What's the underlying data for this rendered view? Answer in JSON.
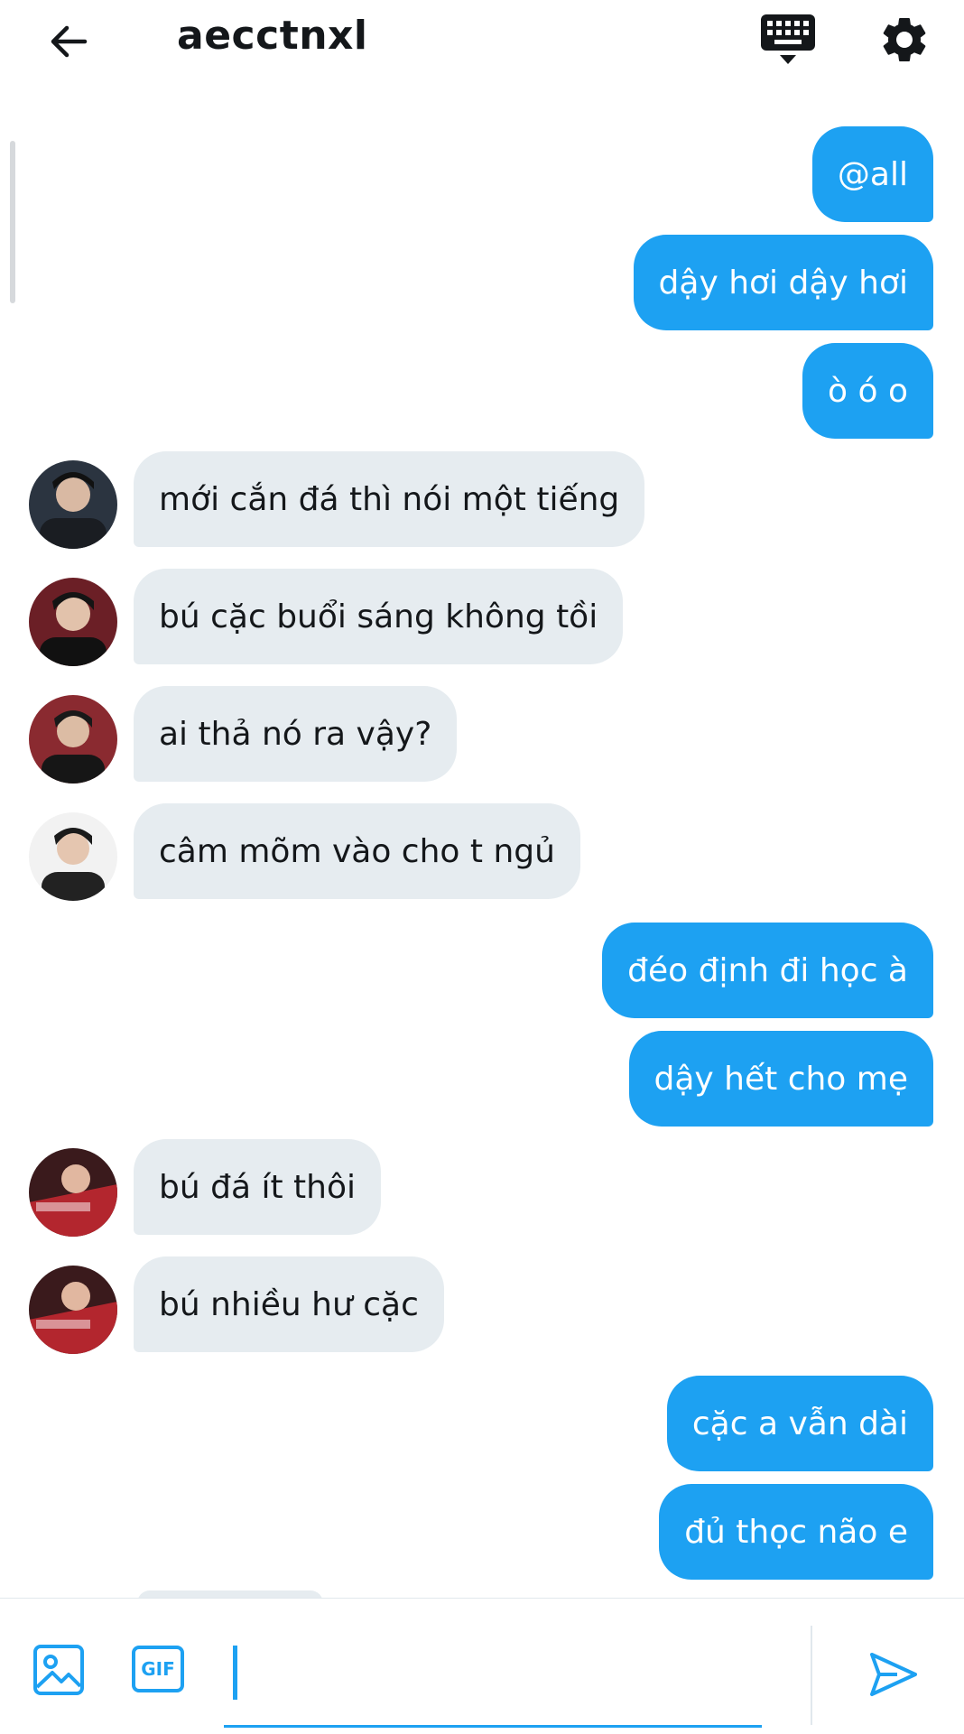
{
  "header": {
    "title": "aecctnxl",
    "back_icon": "arrow-left-icon",
    "keyboard_icon": "keyboard-icon",
    "settings_icon": "gear-icon"
  },
  "colors": {
    "outgoing_bubble": "#1da1f2",
    "incoming_bubble": "#e6ecf0",
    "accent": "#1da1f2"
  },
  "messages": [
    {
      "side": "out",
      "text": "@all"
    },
    {
      "side": "out",
      "text": "dậy hơi dậy hơi"
    },
    {
      "side": "out",
      "text": "ò ó o"
    },
    {
      "side": "in",
      "text": "mới cắn đá thì nói một tiếng"
    },
    {
      "side": "in",
      "text": "bú cặc buổi sáng không tồi"
    },
    {
      "side": "in",
      "text": "ai thả nó ra vậy?"
    },
    {
      "side": "in",
      "text": "câm mõm vào cho t ngủ"
    },
    {
      "side": "out",
      "text": "đéo định đi học à"
    },
    {
      "side": "out",
      "text": "dậy hết cho mẹ"
    },
    {
      "side": "in",
      "text": "bú đá ít thôi"
    },
    {
      "side": "in",
      "text": "bú nhiều hư cặc"
    },
    {
      "side": "out",
      "text": "cặc a vẫn dài"
    },
    {
      "side": "out",
      "text": "đủ thọc não e"
    }
  ],
  "composer": {
    "image_icon": "image-icon",
    "gif_label": "GIF",
    "send_icon": "send-icon",
    "input_value": ""
  }
}
